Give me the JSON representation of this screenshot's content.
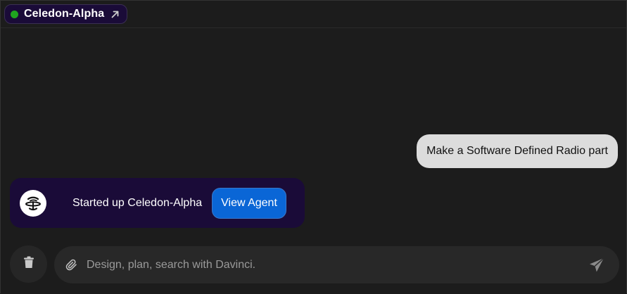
{
  "header": {
    "agent_name": "Celedon-Alpha",
    "status_color": "#1fa51f",
    "status_icon": "status-dot-icon",
    "link_icon": "external-link-icon"
  },
  "chat": {
    "user_message": "Make a Software Defined Radio part",
    "agent_card": {
      "logo_icon": "agent-logo-icon",
      "text": "Started up Celedon-Alpha",
      "button_label": "View Agent"
    }
  },
  "composer": {
    "delete_icon": "trash-icon",
    "attach_icon": "paperclip-icon",
    "placeholder": "Design, plan, search with Davinci.",
    "value": "",
    "send_icon": "send-icon"
  },
  "colors": {
    "background": "#1c1c1c",
    "agent_accent": "#1a0b38",
    "button_primary": "#0a66d6",
    "user_bubble": "#dcdcdc"
  }
}
